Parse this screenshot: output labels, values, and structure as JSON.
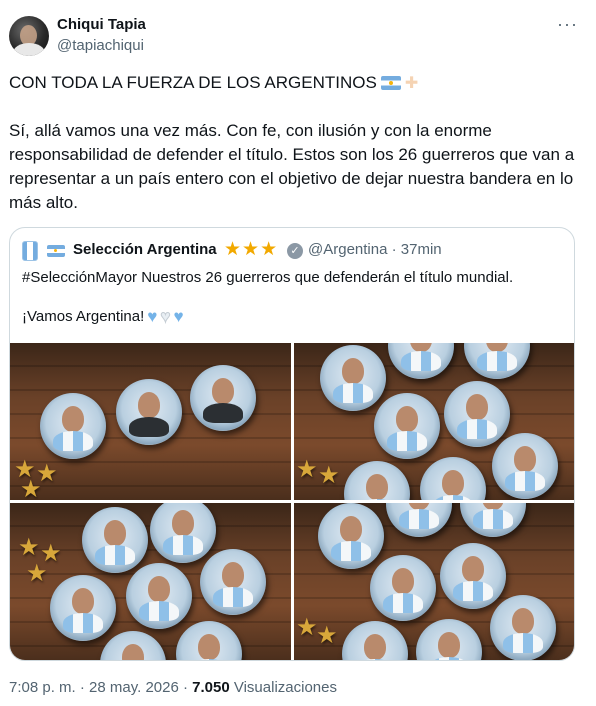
{
  "author": {
    "name": "Chiqui Tapia",
    "handle": "@tapiachiqui"
  },
  "menu": {
    "more_label": "···"
  },
  "tweet": {
    "headline": "CON TODA LA FUERZA DE LOS ARGENTINOS",
    "body": "Sí, allá vamos una vez más. Con fe, con ilusión y con la enorme responsabilidad de defender el título. Estos son los 26 guerreros que van a representar a un país entero con el objetivo de dejar nuestra bandera en lo más alto."
  },
  "quoted": {
    "name": "Selección Argentina",
    "star_glyph": "★",
    "verified_glyph": "✓",
    "handle_time": "@Argentina · 37min",
    "line1": "#SelecciónMayor Nuestros 26 guerreros que defenderán el título mundial.",
    "line2": "¡Vamos Argentina!",
    "heart_glyph": "♥",
    "images": [
      "pins-photo-1",
      "pins-photo-2",
      "pins-photo-3",
      "pins-photo-4"
    ]
  },
  "meta": {
    "time_date": "7:08 p. m. · 28 may. 2026 · ",
    "views_count": "7.050",
    "views_label": " Visualizaciones"
  },
  "colors": {
    "text": "#0f1419",
    "secondary": "#536471",
    "border": "#cfd9de",
    "gold_star": "#f2a900",
    "argentina_blue": "#74acdf"
  }
}
